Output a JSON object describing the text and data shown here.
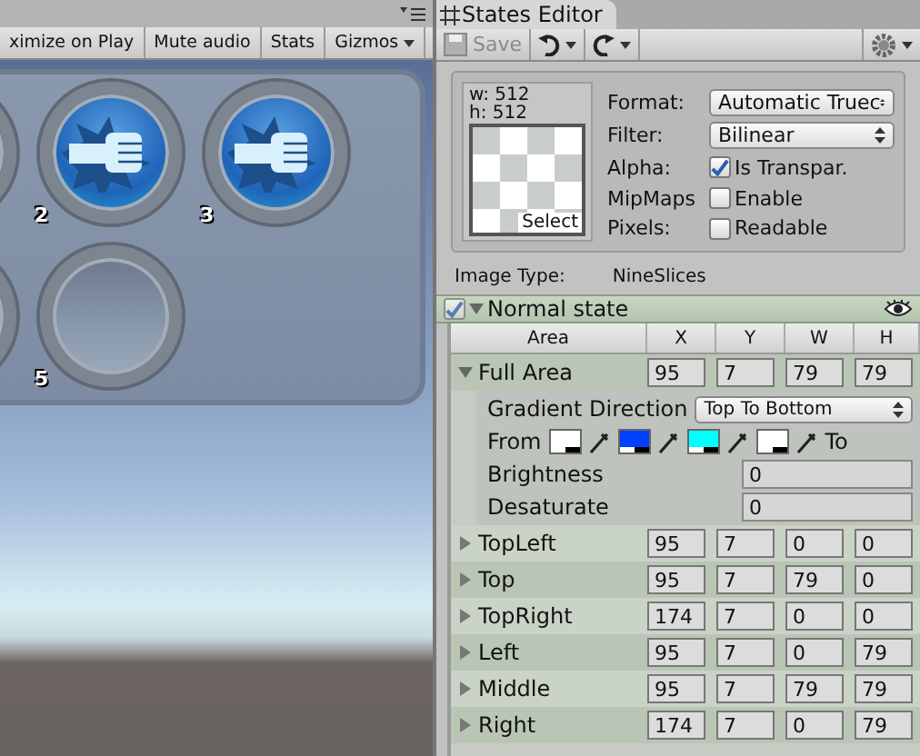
{
  "game_view": {
    "toolbar": [
      {
        "label": "ximize on Play",
        "dropdown": false
      },
      {
        "label": "Mute audio",
        "dropdown": false
      },
      {
        "label": "Stats",
        "dropdown": false
      },
      {
        "label": "Gizmos",
        "dropdown": true
      }
    ],
    "slot_rows": [
      [
        {
          "filled": true
        },
        {
          "filled": true,
          "number": "2"
        },
        {
          "filled": true,
          "number": "3"
        }
      ],
      [
        {
          "filled": true
        },
        {
          "filled": false,
          "number": "5"
        }
      ]
    ]
  },
  "inspector": {
    "tab": {
      "title": "States Editor"
    },
    "toolbar": {
      "save": {
        "label": "Save",
        "disabled": true
      }
    },
    "texture": {
      "width": "w: 512",
      "height": "h: 512",
      "select": "Select",
      "fields": [
        {
          "kind": "dropdown",
          "label": "Format:",
          "value": "Automatic Truec"
        },
        {
          "kind": "dropdown",
          "label": "Filter:",
          "value": "Bilinear"
        },
        {
          "kind": "checkbox",
          "label": "Alpha:",
          "text": "Is Transpar.",
          "checked": true
        },
        {
          "kind": "checkbox",
          "label": "MipMaps",
          "text": "Enable",
          "checked": false
        },
        {
          "kind": "checkbox",
          "label": "Pixels:",
          "text": "Readable",
          "checked": false
        }
      ]
    },
    "image_type": {
      "label": "Image Type:",
      "value": "NineSlices"
    },
    "state": {
      "title": "Normal state",
      "enabled": true,
      "expanded": true,
      "columns": [
        "Area",
        "X",
        "Y",
        "W",
        "H"
      ],
      "areas": [
        {
          "name": "Full Area",
          "expanded": true,
          "values": [
            "95",
            "7",
            "79",
            "79"
          ],
          "gradient": {
            "direction_label": "Gradient Direction",
            "direction": "Top To Bottom",
            "from_label": "From",
            "to_label": "To",
            "colors": [
              {
                "color": "#ffffff"
              },
              {
                "color": "#0040ff"
              },
              {
                "color": "#00ffff"
              },
              {
                "color": "#ffffff"
              }
            ],
            "fields": [
              {
                "label": "Brightness",
                "value": "0"
              },
              {
                "label": "Desaturate",
                "value": "0"
              }
            ]
          }
        },
        {
          "name": "TopLeft",
          "expanded": false,
          "values": [
            "95",
            "7",
            "0",
            "0"
          ]
        },
        {
          "name": "Top",
          "expanded": false,
          "values": [
            "95",
            "7",
            "79",
            "0"
          ]
        },
        {
          "name": "TopRight",
          "expanded": false,
          "values": [
            "174",
            "7",
            "0",
            "0"
          ]
        },
        {
          "name": "Left",
          "expanded": false,
          "values": [
            "95",
            "7",
            "0",
            "79"
          ]
        },
        {
          "name": "Middle",
          "expanded": false,
          "values": [
            "95",
            "7",
            "79",
            "79"
          ]
        },
        {
          "name": "Right",
          "expanded": false,
          "values": [
            "174",
            "7",
            "0",
            "79"
          ]
        }
      ]
    }
  }
}
